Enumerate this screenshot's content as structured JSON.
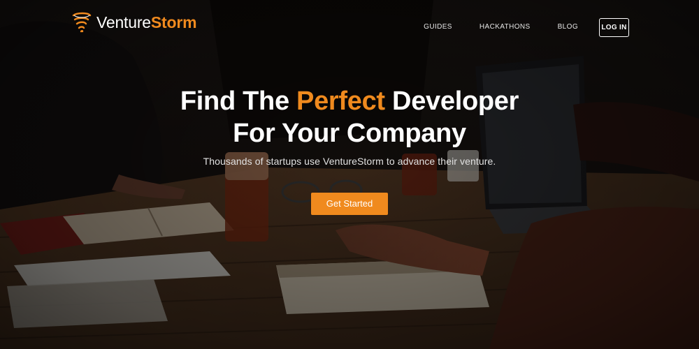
{
  "brand": {
    "name_part1": "Venture",
    "name_part2": "Storm",
    "accent_color": "#f08a1e"
  },
  "nav": {
    "links": [
      {
        "label": "GUIDES"
      },
      {
        "label": "HACKATHONS"
      },
      {
        "label": "BLOG"
      }
    ],
    "login_label": "LOG IN"
  },
  "hero": {
    "headline_pre": "Find The ",
    "headline_accent": "Perfect",
    "headline_post": " Developer",
    "headline_line2": "For Your Company",
    "subhead": "Thousands of startups use VentureStorm to advance their venture.",
    "cta_label": "Get Started",
    "background_image": "photo of people working at a wooden table with laptops and notebooks"
  },
  "icons": {
    "logo": "tornado-icon"
  }
}
